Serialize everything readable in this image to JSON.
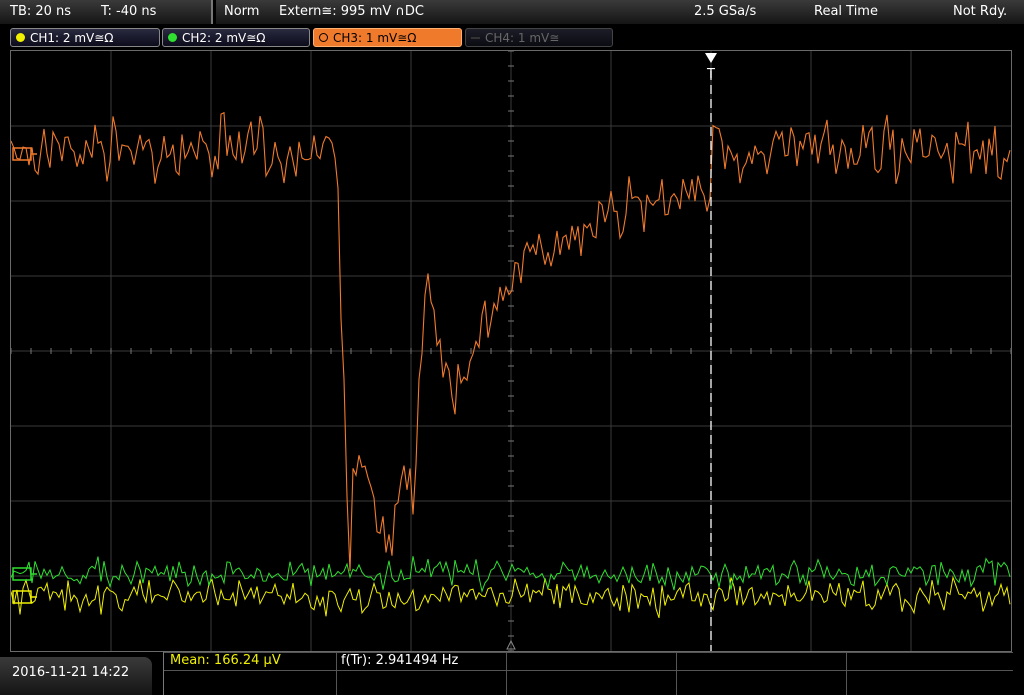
{
  "timebase": {
    "tb": "TB: 20 ns",
    "t": "T: -40 ns"
  },
  "status": {
    "mode": "Norm",
    "trigger": "Extern≅: 995 mV ∩DC",
    "sample_rate": "2.5 GSa/s",
    "acq": "Real Time",
    "state": "Not Rdy."
  },
  "channels": [
    {
      "label": "CH1: 2 mV≅Ω",
      "color": "#f0f000",
      "state": "on"
    },
    {
      "label": "CH2: 2 mV≅Ω",
      "color": "#30e030",
      "state": "on"
    },
    {
      "label": "CH3: 1 mV≅Ω",
      "color": "#f07a2c",
      "state": "active"
    },
    {
      "label": "CH4: 1 mV≅",
      "color": "#555555",
      "state": "off"
    }
  ],
  "trigger_marker": "T",
  "datetime": "2016-11-21 14:22",
  "measurements": {
    "mean_label": "Mean: 166.24 µV",
    "freq_label": "f(Tr): 2.941494 Hz"
  },
  "colors": {
    "ch1": "#f0f000",
    "ch2": "#30e030",
    "ch3": "#f07a2c",
    "grid": "#3a3a3a",
    "mean_text": "#f0f000"
  }
}
